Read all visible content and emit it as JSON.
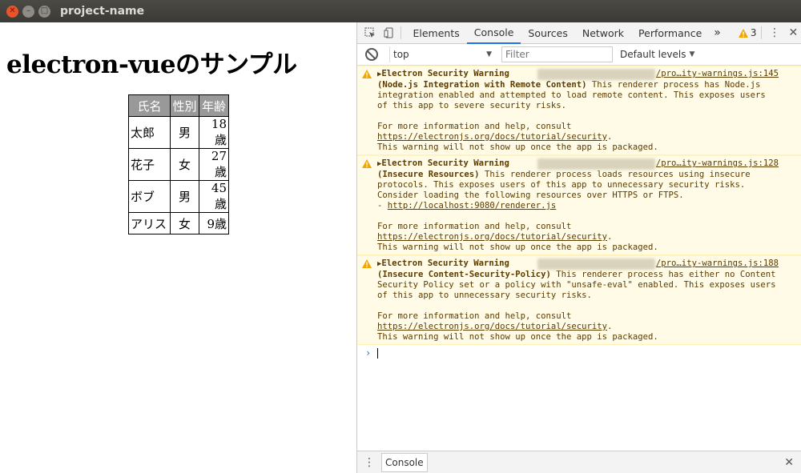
{
  "window": {
    "title": "project-name"
  },
  "app": {
    "heading": "electron-vueのサンプル",
    "table": {
      "headers": [
        "氏名",
        "性別",
        "年齢"
      ],
      "rows": [
        [
          "太郎",
          "男",
          "18歳"
        ],
        [
          "花子",
          "女",
          "27歳"
        ],
        [
          "ボブ",
          "男",
          "45歳"
        ],
        [
          "アリス",
          "女",
          "9歳"
        ]
      ]
    }
  },
  "devtools": {
    "tabs": [
      "Elements",
      "Console",
      "Sources",
      "Network",
      "Performance"
    ],
    "active_tab": "Console",
    "more": "»",
    "warning_count": "3",
    "console": {
      "context": "top",
      "filter_placeholder": "Filter",
      "levels": "Default levels"
    },
    "messages": [
      {
        "title": "Electron Security Warning",
        "source": "/pro…ity-warnings.js:145",
        "subtitle": "(Node.js Integration with Remote Content)",
        "body": " This renderer process has Node.js integration enabled and attempted to load remote content. This exposes users of this app to severe security risks.",
        "help": "For more information and help, consult ",
        "link": "https://electronjs.org/docs/tutorial/security",
        "footer": "This warning will not show up once the app is packaged."
      },
      {
        "title": "Electron Security Warning",
        "source": "/pro…ity-warnings.js:128",
        "subtitle": "(Insecure Resources)",
        "body": " This renderer process loads resources using insecure protocols. This exposes users of this app to unnecessary security risks. Consider loading the following resources over HTTPS or FTPS.",
        "extra_prefix": "- ",
        "extra_link": "http://localhost:9080/renderer.js",
        "help": "For more information and help, consult ",
        "link": "https://electronjs.org/docs/tutorial/security",
        "footer": "This warning will not show up once the app is packaged."
      },
      {
        "title": "Electron Security Warning",
        "source": "/pro…ity-warnings.js:188",
        "subtitle": "(Insecure Content-Security-Policy)",
        "body": " This renderer process has either no Content Security Policy set or a policy with \"unsafe-eval\" enabled. This exposes users of this app to unnecessary security risks.",
        "help": "For more information and help, consult ",
        "link": "https://electronjs.org/docs/tutorial/security",
        "footer": "This warning will not show up once the app is packaged."
      }
    ],
    "drawer": {
      "tab": "Console"
    }
  }
}
